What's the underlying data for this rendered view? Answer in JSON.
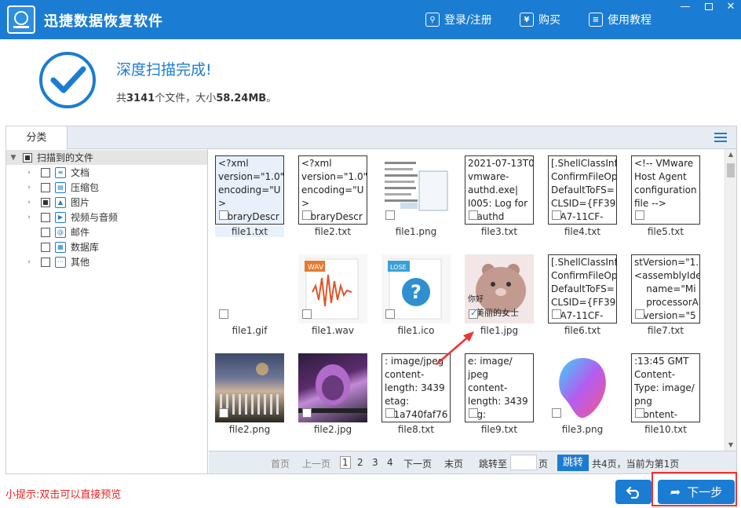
{
  "titlebar": {
    "app_title": "迅捷数据恢复软件",
    "login": "登录/注册",
    "buy": "购买",
    "buy_icon": "¥",
    "tutorial": "使用教程",
    "min_glyph": "—",
    "close_glyph": "✕"
  },
  "status": {
    "title": "深度扫描完成!",
    "prefix": "共",
    "count": "3141",
    "mid": "个文件，大小",
    "size": "58.24MB",
    "suffix": "。"
  },
  "panel": {
    "tab_label": "分类"
  },
  "tree": {
    "root": "扫描到的文件",
    "items": [
      {
        "label": "文档",
        "icon": "document-icon",
        "glyph": "≡",
        "expandable": true
      },
      {
        "label": "压缩包",
        "icon": "archive-icon",
        "glyph": "▤",
        "expandable": true
      },
      {
        "label": "图片",
        "icon": "picture-icon",
        "glyph": "▲",
        "expandable": true
      },
      {
        "label": "视频与音频",
        "icon": "video-icon",
        "glyph": "▶",
        "expandable": true
      },
      {
        "label": "邮件",
        "icon": "mail-icon",
        "glyph": "@",
        "expandable": false
      },
      {
        "label": "数据库",
        "icon": "database-icon",
        "glyph": "▦",
        "expandable": false
      },
      {
        "label": "其他",
        "icon": "other-icon",
        "glyph": "···",
        "expandable": true
      }
    ]
  },
  "files": {
    "row1": [
      {
        "name": "file1.txt",
        "preview": "<?xml\nversion=\"1.0\"\nencoding=\"U\n>\n   braryDescr"
      },
      {
        "name": "file2.txt",
        "preview": "<?xml\nversion=\"1.0\"\nencoding=\"U\n>\n   braryDescr"
      },
      {
        "name": "file1.png",
        "preview": ""
      },
      {
        "name": "file3.txt",
        "preview": "2021-07-13T0\nvmware-\nauthd.exe|\nI005: Log for\n   authd"
      },
      {
        "name": "file4.txt",
        "preview": "[.ShellClassInf\nConfirmFileOp\nDefaultToFS=\nCLSID={FF393\n   A7-11CF-"
      },
      {
        "name": "file5.txt",
        "preview": "<!-- VMware\nHost Agent\nconfiguration\nfile -->"
      }
    ],
    "row2": [
      {
        "name": "file1.gif",
        "preview": ""
      },
      {
        "name": "file1.wav",
        "preview": ""
      },
      {
        "name": "file1.ico",
        "preview": ""
      },
      {
        "name": "file1.jpg",
        "preview": ""
      },
      {
        "name": "file6.txt",
        "preview": "[.ShellClassInf\nConfirmFileOp\nDefaultToFS=\nCLSID={FF393\n   A7-11CF-"
      },
      {
        "name": "file7.txt",
        "preview": "stVersion=\"1.\n<assemblyIde\n    name=\"Mi\n    processorA\n   version=\"5"
      }
    ],
    "row3": [
      {
        "name": "file2.png",
        "preview": ""
      },
      {
        "name": "file2.jpg",
        "preview": ""
      },
      {
        "name": "file8.txt",
        "preview": ": image/jpeg\ncontent-\nlength: 3439\netag:\n   1a740faf76"
      },
      {
        "name": "file9.txt",
        "preview": "e: image/\njpeg\ncontent-\nlength: 3439\n   g:"
      },
      {
        "name": "file3.png",
        "preview": ""
      },
      {
        "name": "file10.txt",
        "preview": ":13:45 GMT\nContent-\nType: image/\npng\n   ontent-"
      }
    ],
    "jpg_caption_1": "你好",
    "jpg_caption_2": "美丽的女士",
    "wav_badge": "WAV",
    "ico_badge": "LOSE"
  },
  "pager": {
    "first": "首页",
    "prev": "上一页",
    "pages": [
      "1",
      "2",
      "3",
      "4"
    ],
    "next": "下一页",
    "last": "末页",
    "jump_to": "跳转至",
    "page_unit": "页",
    "jump_button": "跳转",
    "summary": "共4页，当前为第1页"
  },
  "footer": {
    "hint": "小提示:双击可以直接预览",
    "next_button": "下一步"
  },
  "colors": {
    "accent": "#1b7cd3",
    "highlight": "#e33333"
  }
}
